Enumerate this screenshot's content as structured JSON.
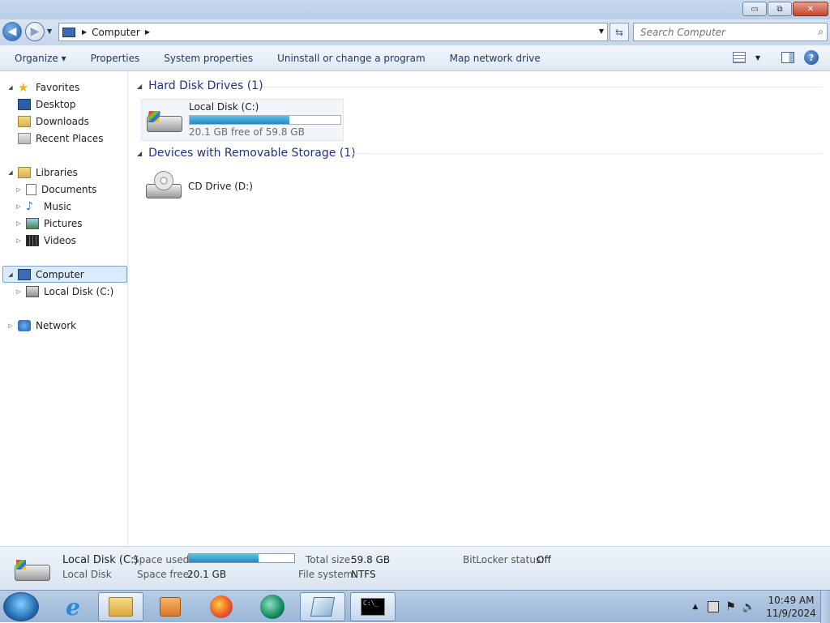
{
  "window": {
    "minimize": "▭",
    "maximize": "⧉",
    "close": "✕"
  },
  "address": {
    "breadcrumb": "Computer",
    "search_placeholder": "Search Computer"
  },
  "toolbar": {
    "organize": "Organize ▾",
    "properties": "Properties",
    "system_properties": "System properties",
    "uninstall": "Uninstall or change a program",
    "map_drive": "Map network drive"
  },
  "nav": {
    "favorites": "Favorites",
    "desktop": "Desktop",
    "downloads": "Downloads",
    "recent": "Recent Places",
    "libraries": "Libraries",
    "documents": "Documents",
    "music": "Music",
    "pictures": "Pictures",
    "videos": "Videos",
    "computer": "Computer",
    "local_disk": "Local Disk (C:)",
    "network": "Network"
  },
  "groups": {
    "hdd": "Hard Disk Drives (1)",
    "removable": "Devices with Removable Storage (1)"
  },
  "drives": {
    "c_name": "Local Disk (C:)",
    "c_free": "20.1 GB free of 59.8 GB",
    "c_used_fraction": 0.66,
    "d_name": "CD Drive (D:)"
  },
  "status": {
    "name": "Local Disk (C:)",
    "type": "Local Disk",
    "space_used_label": "Space used:",
    "space_used_fraction": 0.66,
    "space_free_label": "Space free:",
    "space_free": "20.1 GB",
    "total_label": "Total size:",
    "total": "59.8 GB",
    "fs_label": "File system:",
    "fs": "NTFS",
    "bitlocker_label": "BitLocker status:",
    "bitlocker": "Off"
  },
  "clock": {
    "time": "10:49 AM",
    "date": "11/9/2024"
  },
  "colors": {
    "accent": "#1e3287",
    "selection": "#dcebfc",
    "bar_fill": "#2689c4"
  }
}
